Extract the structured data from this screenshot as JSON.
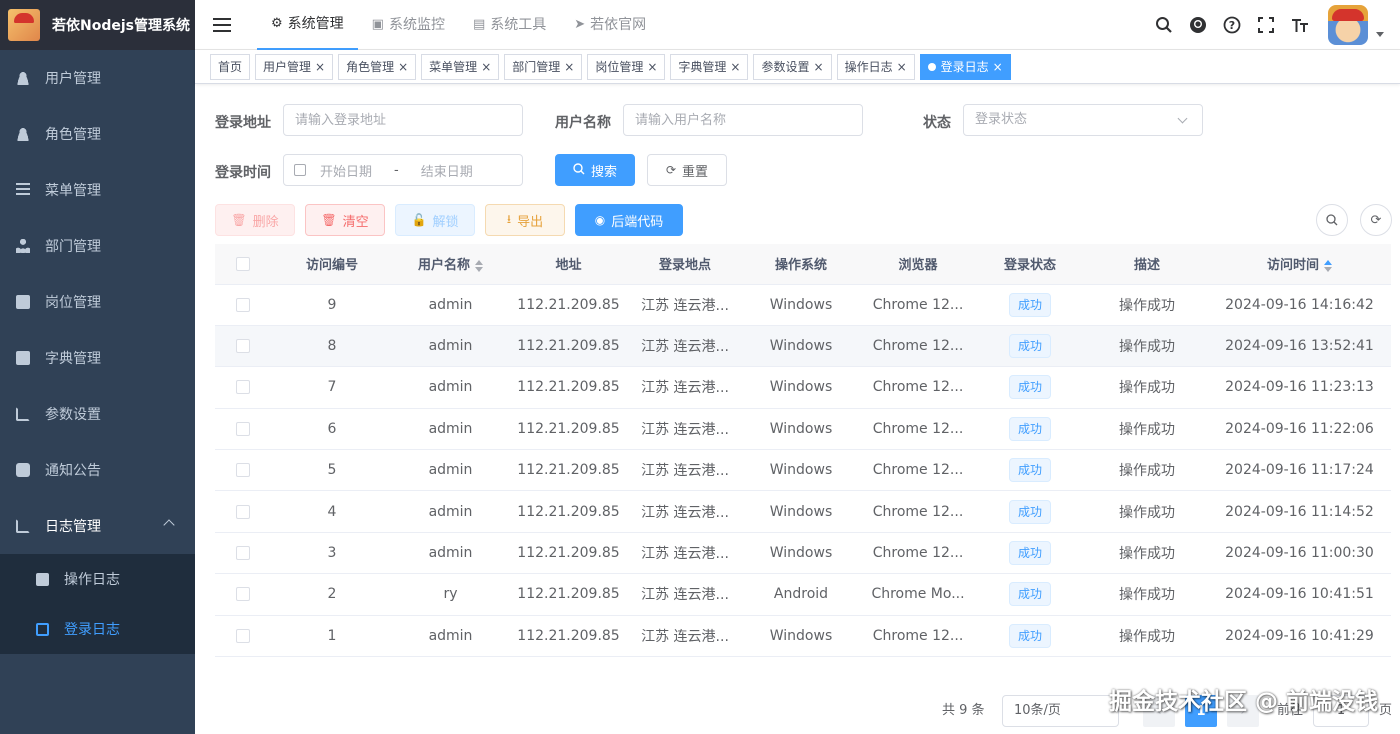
{
  "app": {
    "title": "若依Nodejs管理系统"
  },
  "sidebar": {
    "items": [
      {
        "label": "用户管理",
        "icon": "user-icon"
      },
      {
        "label": "角色管理",
        "icon": "peoples-icon"
      },
      {
        "label": "菜单管理",
        "icon": "tree-table-icon"
      },
      {
        "label": "部门管理",
        "icon": "tree-icon"
      },
      {
        "label": "岗位管理",
        "icon": "post-icon"
      },
      {
        "label": "字典管理",
        "icon": "dict-icon"
      },
      {
        "label": "参数设置",
        "icon": "edit-icon"
      },
      {
        "label": "通知公告",
        "icon": "message-icon"
      },
      {
        "label": "日志管理",
        "icon": "log-icon"
      }
    ],
    "sub_items": [
      {
        "label": "操作日志",
        "icon": "form-icon"
      },
      {
        "label": "登录日志",
        "icon": "logininfor-icon"
      }
    ]
  },
  "topnav": {
    "items": [
      {
        "label": "系统管理",
        "icon": "gear-icon"
      },
      {
        "label": "系统监控",
        "icon": "monitor-icon"
      },
      {
        "label": "系统工具",
        "icon": "tool-icon"
      },
      {
        "label": "若依官网",
        "icon": "send-icon"
      }
    ]
  },
  "tags": [
    {
      "label": "首页"
    },
    {
      "label": "用户管理"
    },
    {
      "label": "角色管理"
    },
    {
      "label": "菜单管理"
    },
    {
      "label": "部门管理"
    },
    {
      "label": "岗位管理"
    },
    {
      "label": "字典管理"
    },
    {
      "label": "参数设置"
    },
    {
      "label": "操作日志"
    },
    {
      "label": "登录日志"
    }
  ],
  "search": {
    "ip_label": "登录地址",
    "ip_placeholder": "请输入登录地址",
    "user_label": "用户名称",
    "user_placeholder": "请输入用户名称",
    "status_label": "状态",
    "status_placeholder": "登录状态",
    "time_label": "登录时间",
    "start_placeholder": "开始日期",
    "range_sep": "-",
    "end_placeholder": "结束日期",
    "search_btn": "搜索",
    "reset_btn": "重置"
  },
  "toolbar": {
    "delete": "删除",
    "clean": "清空",
    "unlock": "解锁",
    "export": "导出",
    "backend": "后端代码"
  },
  "table": {
    "headers": [
      "访问编号",
      "用户名称",
      "地址",
      "登录地点",
      "操作系统",
      "浏览器",
      "登录状态",
      "描述",
      "访问时间"
    ],
    "rows": [
      {
        "id": "9",
        "user": "admin",
        "ip": "112.21.209.85",
        "loc": "江苏 连云港...",
        "os": "Windows",
        "browser": "Chrome 12...",
        "status": "成功",
        "msg": "操作成功",
        "time": "2024-09-16 14:16:42"
      },
      {
        "id": "8",
        "user": "admin",
        "ip": "112.21.209.85",
        "loc": "江苏 连云港...",
        "os": "Windows",
        "browser": "Chrome 12...",
        "status": "成功",
        "msg": "操作成功",
        "time": "2024-09-16 13:52:41"
      },
      {
        "id": "7",
        "user": "admin",
        "ip": "112.21.209.85",
        "loc": "江苏 连云港...",
        "os": "Windows",
        "browser": "Chrome 12...",
        "status": "成功",
        "msg": "操作成功",
        "time": "2024-09-16 11:23:13"
      },
      {
        "id": "6",
        "user": "admin",
        "ip": "112.21.209.85",
        "loc": "江苏 连云港...",
        "os": "Windows",
        "browser": "Chrome 12...",
        "status": "成功",
        "msg": "操作成功",
        "time": "2024-09-16 11:22:06"
      },
      {
        "id": "5",
        "user": "admin",
        "ip": "112.21.209.85",
        "loc": "江苏 连云港...",
        "os": "Windows",
        "browser": "Chrome 12...",
        "status": "成功",
        "msg": "操作成功",
        "time": "2024-09-16 11:17:24"
      },
      {
        "id": "4",
        "user": "admin",
        "ip": "112.21.209.85",
        "loc": "江苏 连云港...",
        "os": "Windows",
        "browser": "Chrome 12...",
        "status": "成功",
        "msg": "操作成功",
        "time": "2024-09-16 11:14:52"
      },
      {
        "id": "3",
        "user": "admin",
        "ip": "112.21.209.85",
        "loc": "江苏 连云港...",
        "os": "Windows",
        "browser": "Chrome 12...",
        "status": "成功",
        "msg": "操作成功",
        "time": "2024-09-16 11:00:30"
      },
      {
        "id": "2",
        "user": "ry",
        "ip": "112.21.209.85",
        "loc": "江苏 连云港...",
        "os": "Android",
        "browser": "Chrome Mo...",
        "status": "成功",
        "msg": "操作成功",
        "time": "2024-09-16 10:41:51"
      },
      {
        "id": "1",
        "user": "admin",
        "ip": "112.21.209.85",
        "loc": "江苏 连云港...",
        "os": "Windows",
        "browser": "Chrome 12...",
        "status": "成功",
        "msg": "操作成功",
        "time": "2024-09-16 10:41:29"
      }
    ]
  },
  "pagination": {
    "total": "共 9 条",
    "page_size": "10条/页",
    "prev": "‹",
    "current": "1",
    "next": "›",
    "goto": "前往",
    "goto_value": "1",
    "page_unit": "页"
  },
  "watermark": "掘金技术社区 @ 前端没钱",
  "colors": {
    "primary": "#409eff",
    "sidebar_bg": "#304156",
    "submenu_bg": "#1f2d3d",
    "danger": "#f56c6c",
    "warning": "#e6a23c"
  }
}
